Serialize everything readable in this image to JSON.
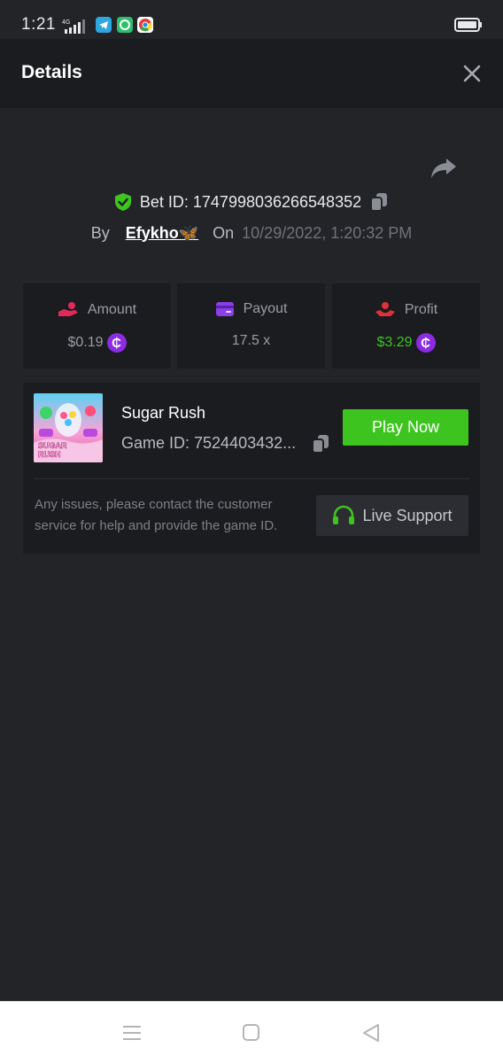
{
  "status_bar": {
    "time": "1:21",
    "network": "4G"
  },
  "header": {
    "title": "Details"
  },
  "bet": {
    "bet_id_label": "Bet ID: 1747998036266548352",
    "by_label": "By",
    "user": "Efykho🦋",
    "on_label": "On",
    "date": "10/29/2022, 1:20:32 PM"
  },
  "stats": [
    {
      "label": "Amount",
      "value": "$0.19",
      "icon": "hand-coin-icon",
      "color": "#e02a5c"
    },
    {
      "label": "Payout",
      "value": "17.5 x",
      "icon": "card-icon",
      "color": "#8b3fe6"
    },
    {
      "label": "Profit",
      "value": "$3.29",
      "icon": "hand-coin-icon",
      "color": "#e0313a"
    }
  ],
  "coin_symbol": "₵",
  "game": {
    "name": "Sugar Rush",
    "game_id": "Game ID: 7524403432...",
    "thumb_text_line1": "SUGAR",
    "thumb_text_line2": "RUSH",
    "play_label": "Play Now",
    "issue_text": "Any issues, please contact the customer service for help and provide the game ID.",
    "support_label": "Live Support"
  },
  "colors": {
    "accent_green": "#3ec41f",
    "coin_purple": "#8b2be2",
    "background": "#232428",
    "card": "#1b1c1f"
  }
}
